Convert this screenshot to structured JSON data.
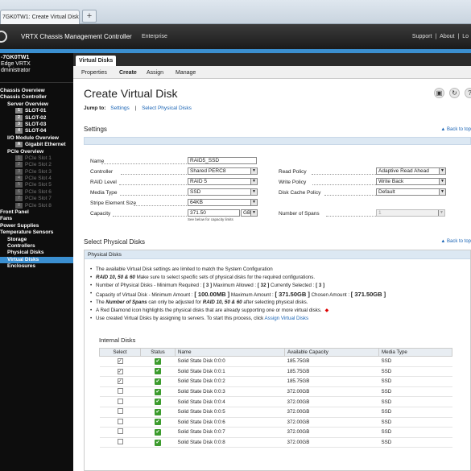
{
  "browser": {
    "tab_title": "7GK0TW1: Create Virtual Disk",
    "new_tab": "+"
  },
  "header": {
    "product": "VRTX Chassis Management Controller",
    "edition": "Enterprise",
    "links": [
      "Support",
      "|",
      "About",
      "|",
      "Lo"
    ]
  },
  "sidebar": {
    "host": "-7GK0TW1",
    "model": "Edge VRTX",
    "role": "dministrator",
    "items": [
      {
        "label": "Chassis Overview",
        "level": "l0"
      },
      {
        "label": "Chassis Controller",
        "level": "l0"
      },
      {
        "label": "Server Overview",
        "level": "l1"
      },
      {
        "label": "SLOT-01",
        "level": "slot",
        "num": "1"
      },
      {
        "label": "SLOT-02",
        "level": "slot",
        "num": "2"
      },
      {
        "label": "SLOT-03",
        "level": "slot",
        "num": "3"
      },
      {
        "label": "SLOT-04",
        "level": "slot",
        "num": "4"
      },
      {
        "label": "I/O Module Overview",
        "level": "l1"
      },
      {
        "label": "Gigabit Ethernet",
        "level": "slot",
        "num": "A"
      },
      {
        "label": "PCIe Overview",
        "level": "l1"
      },
      {
        "label": "PCIe Slot 1",
        "level": "slot dim",
        "num": "1"
      },
      {
        "label": "PCIe Slot 2",
        "level": "slot dim",
        "num": "2"
      },
      {
        "label": "PCIe Slot 3",
        "level": "slot dim",
        "num": "3"
      },
      {
        "label": "PCIe Slot 4",
        "level": "slot dim",
        "num": "4"
      },
      {
        "label": "PCIe Slot 5",
        "level": "slot dim",
        "num": "5"
      },
      {
        "label": "PCIe Slot 6",
        "level": "slot dim",
        "num": "6"
      },
      {
        "label": "PCIe Slot 7",
        "level": "slot dim",
        "num": "7"
      },
      {
        "label": "PCIe Slot 8",
        "level": "slot dim",
        "num": "8"
      },
      {
        "label": "Front Panel",
        "level": "l0"
      },
      {
        "label": "Fans",
        "level": "l0"
      },
      {
        "label": "Power Supplies",
        "level": "l0"
      },
      {
        "label": "Temperature Sensors",
        "level": "l0"
      },
      {
        "label": "Storage",
        "level": "l1"
      },
      {
        "label": "Controllers",
        "level": "l1"
      },
      {
        "label": "Physical Disks",
        "level": "l1"
      },
      {
        "label": "Virtual Disks",
        "level": "l1 active"
      },
      {
        "label": "Enclosures",
        "level": "l1"
      }
    ]
  },
  "tabs": {
    "active": "Virtual Disks",
    "subtabs": [
      "Properties",
      "Create",
      "Assign",
      "Manage"
    ]
  },
  "page": {
    "title": "Create Virtual Disk",
    "jump_label": "Jump to:",
    "jump_links": [
      "Settings",
      "|",
      "Select Physical Disks"
    ],
    "icons": [
      "print-icon",
      "refresh-icon",
      "help-icon"
    ]
  },
  "settings": {
    "title": "Settings",
    "back_to_top": "▲ Back to top",
    "name_label": "Name",
    "name_value": "RAID5_SSD",
    "left_fields": [
      {
        "label": "Controller",
        "value": "Shared PERC8"
      },
      {
        "label": "RAID Level",
        "value": "RAID 5"
      },
      {
        "label": "Media Type",
        "value": "SSD"
      },
      {
        "label": "Stripe Element Size",
        "value": "64KB"
      }
    ],
    "capacity_label": "Capacity",
    "capacity_value": "371.50",
    "capacity_unit": "GB",
    "capacity_note": "See below for capacity limits",
    "right_fields": [
      {
        "label": "Read Policy",
        "value": "Adaptive Read Ahead"
      },
      {
        "label": "Write Policy",
        "value": "Write Back"
      },
      {
        "label": "Disk Cache Policy",
        "value": "Default"
      }
    ],
    "spans_label": "Number of Spans",
    "spans_value": "1"
  },
  "select_disks": {
    "title": "Select Physical Disks",
    "back_to_top": "▲ Back to top",
    "strip": "Physical Disks",
    "b1": "The available Virtual Disk settings are limited to match the System Configuration",
    "b2_em": "RAID 10, 50 & 60",
    "b2": " Make sure to select specific sets of physical disks for the required configurations.",
    "b3a": "Number of Physical Disks  -  Minimum Required : ",
    "b3_min": "[ 3 ]",
    "b3b": "  Maximum Allowed : ",
    "b3_max": "[ 32 ]",
    "b3c": "  Currently Selected : ",
    "b3_cur": "[ 3 ]",
    "b4a": "Capacity of Virtual Disk  -  Minimum Amount : ",
    "b4_min": "[ 100.00MB ]",
    "b4b": "  Maximum Amount : ",
    "b4_max": "[ 371.50GB ]",
    "b4c": "  Chosen Amount : ",
    "b4_cur": "[ 371.50GB ]",
    "b5a": "The ",
    "b5_em1": "Number of Spans",
    "b5b": " can only be adjusted for ",
    "b5_em2": "RAID 10, 50 & 60",
    "b5c": " after selecting physical disks.",
    "b6": "A Red Diamond icon highlights the physical disks that are already supporting one or more virtual disks.",
    "b7": "Use created Virtual Disks by assigning to servers. To start this process, click ",
    "b7_link": "Assign Virtual Disks",
    "internal_title": "Internal Disks",
    "columns": [
      "Select",
      "Status",
      "Name",
      "Available Capacity",
      "Media Type"
    ],
    "rows": [
      {
        "checked": "✓",
        "name": "Solid State Disk 0:0:0",
        "capacity": "185.75GB",
        "media": "SSD"
      },
      {
        "checked": "✓",
        "name": "Solid State Disk 0:0:1",
        "capacity": "185.75GB",
        "media": "SSD"
      },
      {
        "checked": "✓",
        "name": "Solid State Disk 0:0:2",
        "capacity": "185.75GB",
        "media": "SSD"
      },
      {
        "checked": "",
        "name": "Solid State Disk 0:0:3",
        "capacity": "372.00GB",
        "media": "SSD"
      },
      {
        "checked": "",
        "name": "Solid State Disk 0:0:4",
        "capacity": "372.00GB",
        "media": "SSD"
      },
      {
        "checked": "",
        "name": "Solid State Disk 0:0:5",
        "capacity": "372.00GB",
        "media": "SSD"
      },
      {
        "checked": "",
        "name": "Solid State Disk 0:0:6",
        "capacity": "372.00GB",
        "media": "SSD"
      },
      {
        "checked": "",
        "name": "Solid State Disk 0:0:7",
        "capacity": "372.00GB",
        "media": "SSD"
      },
      {
        "checked": "",
        "name": "Solid State Disk 0:0:8",
        "capacity": "372.00GB",
        "media": "SSD"
      }
    ]
  }
}
